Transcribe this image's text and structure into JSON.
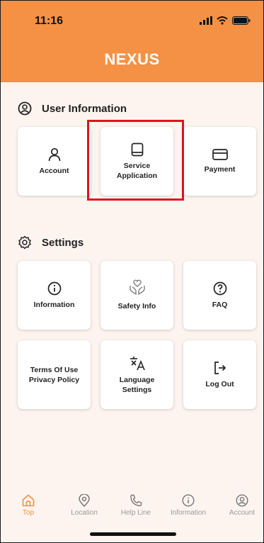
{
  "status_bar": {
    "time": "11:16"
  },
  "header": {
    "title": "NEXUS"
  },
  "user_info": {
    "title": "User Information",
    "cards": [
      {
        "label": "Account",
        "icon": "user-icon"
      },
      {
        "label": "Service\nApplication",
        "icon": "book-icon"
      },
      {
        "label": "Payment",
        "icon": "credit-card-icon"
      }
    ]
  },
  "settings": {
    "title": "Settings",
    "cards": [
      {
        "label": "Information",
        "icon": "info-icon"
      },
      {
        "label": "Safety Info",
        "icon": "hands-heart-icon"
      },
      {
        "label": "FAQ",
        "icon": "question-icon"
      },
      {
        "label": "Terms Of Use\nPrivacy Policy",
        "icon": "none"
      },
      {
        "label": "Language\nSettings",
        "icon": "translate-icon"
      },
      {
        "label": "Log Out",
        "icon": "logout-icon"
      }
    ]
  },
  "tabbar": {
    "active": "Top",
    "items": [
      {
        "label": "Top",
        "icon": "home-icon"
      },
      {
        "label": "Location",
        "icon": "location-pin-icon"
      },
      {
        "label": "Help Line",
        "icon": "phone-icon"
      },
      {
        "label": "Information",
        "icon": "info-icon"
      },
      {
        "label": "Account",
        "icon": "account-icon"
      }
    ]
  },
  "colors": {
    "accent": "#f59145",
    "highlight": "#e0131b",
    "background": "#fdf4ef"
  }
}
